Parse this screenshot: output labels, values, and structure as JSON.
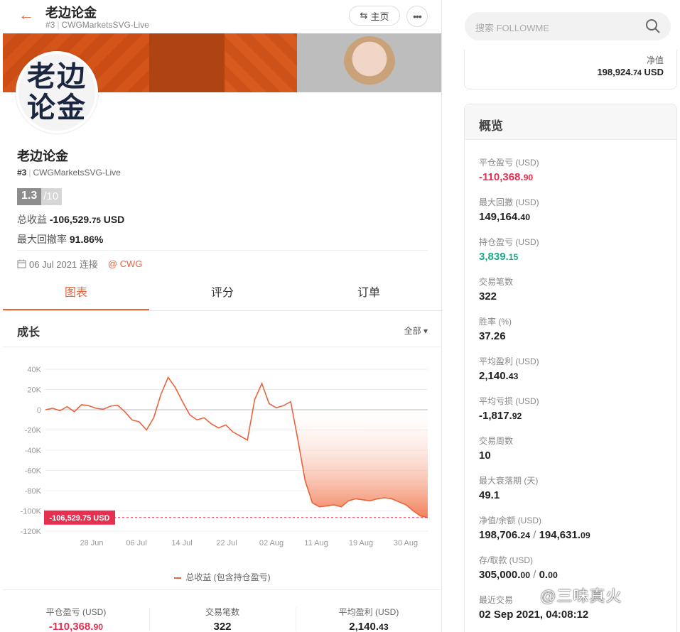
{
  "header": {
    "back_icon": "arrow-left-icon",
    "title": "老边论金",
    "rank": "#3",
    "account": "CWGMarketsSVG-Live",
    "home_label": "主页",
    "more_label": "•••"
  },
  "profile": {
    "avatar_text": "老边论金",
    "name": "老边论金",
    "rank": "#3",
    "account": "CWGMarketsSVG-Live",
    "score": "1.3",
    "score_max": "/10",
    "total_return_label": "总收益",
    "total_return_main": "-106,529.",
    "total_return_dec": "75",
    "total_return_unit": "USD",
    "max_drawdown_label": "最大回撤率",
    "max_drawdown_value": "91.86%",
    "connected_text": "06 Jul 2021 连接",
    "broker": "@ CWG"
  },
  "tabs": [
    {
      "label": "图表",
      "active": true
    },
    {
      "label": "评分",
      "active": false
    },
    {
      "label": "订单",
      "active": false
    }
  ],
  "growth": {
    "title": "成长",
    "filter": "全部"
  },
  "chart_data": {
    "type": "area",
    "x_ticks": [
      "28 Jun",
      "06 Jul",
      "14 Jul",
      "22 Jul",
      "02 Aug",
      "11 Aug",
      "19 Aug",
      "30 Aug"
    ],
    "y_ticks": [
      "40K",
      "20K",
      "0",
      "-20K",
      "-40K",
      "-60K",
      "-80K",
      "-100K",
      "-120K"
    ],
    "ylim": [
      -120000,
      40000
    ],
    "series": [
      {
        "name": "总收益 (包含持仓盈亏)",
        "color": "#e8643c",
        "values": [
          0,
          1500,
          -1000,
          3000,
          -2000,
          5000,
          4000,
          1500,
          500,
          3500,
          4500,
          -2000,
          -10000,
          -12000,
          -20000,
          -8000,
          15000,
          32000,
          22000,
          8000,
          -5000,
          -10000,
          -8000,
          -14000,
          -18000,
          -15000,
          -22000,
          -26000,
          -30000,
          10000,
          26000,
          6000,
          2000,
          4000,
          8000,
          -30000,
          -70000,
          -92000,
          -96000,
          -95000,
          -94000,
          -96000,
          -90000,
          -88000,
          -89000,
          -90000,
          -88000,
          -87000,
          -88000,
          -91000,
          -94000,
          -100000,
          -105000,
          -106529.75
        ]
      }
    ],
    "current_label": "-106,529.75 USD",
    "current_value": -106529.75,
    "legend": "总收益 (包含持仓盈亏)"
  },
  "bottom_stats": [
    {
      "label": "平仓盈亏 (USD)",
      "main": "-110,368.",
      "dec": "90",
      "tone": "red"
    },
    {
      "label": "交易笔数",
      "main": "322",
      "dec": "",
      "tone": "normal"
    },
    {
      "label": "平均盈利 (USD)",
      "main": "2,140.",
      "dec": "43",
      "tone": "normal"
    }
  ],
  "search": {
    "placeholder": "搜索 FOLLOWME",
    "icon": "search-icon"
  },
  "equity": {
    "label": "净值",
    "main": "198,924.",
    "dec": "74",
    "unit": "USD"
  },
  "overview": {
    "title": "概览",
    "items": [
      {
        "label": "平仓盈亏 (USD)",
        "main": "-110,368.",
        "dec": "90",
        "tone": "red"
      },
      {
        "label": "最大回撤 (USD)",
        "main": "149,164.",
        "dec": "40",
        "tone": "normal"
      },
      {
        "label": "持仓盈亏 (USD)",
        "main": "3,839.",
        "dec": "15",
        "tone": "green"
      },
      {
        "label": "交易笔数",
        "main": "322",
        "dec": "",
        "tone": "normal"
      },
      {
        "label": "胜率 (%)",
        "main": "37.26",
        "dec": "",
        "tone": "normal"
      },
      {
        "label": "平均盈利 (USD)",
        "main": "2,140.",
        "dec": "43",
        "tone": "normal"
      },
      {
        "label": "平均亏损 (USD)",
        "main": "-1,817.",
        "dec": "92",
        "tone": "normal"
      },
      {
        "label": "交易周数",
        "main": "10",
        "dec": "",
        "tone": "normal"
      },
      {
        "label": "最大衰落期 (天)",
        "main": "49.1",
        "dec": "",
        "tone": "normal"
      },
      {
        "label": "净值/余额 (USD)",
        "main": "198,706.",
        "dec": "24",
        "tone": "normal",
        "extra_sep": " / ",
        "extra_main": "194,631.",
        "extra_dec": "09"
      },
      {
        "label": "存/取款 (USD)",
        "main": "305,000.",
        "dec": "00",
        "tone": "normal",
        "extra_sep": " / ",
        "extra_main": "0.",
        "extra_dec": "00"
      },
      {
        "label": "最近交易",
        "main": "02 Sep 2021, 04:08:12",
        "dec": "",
        "tone": "normal"
      }
    ]
  },
  "watermark": "@三味真火"
}
